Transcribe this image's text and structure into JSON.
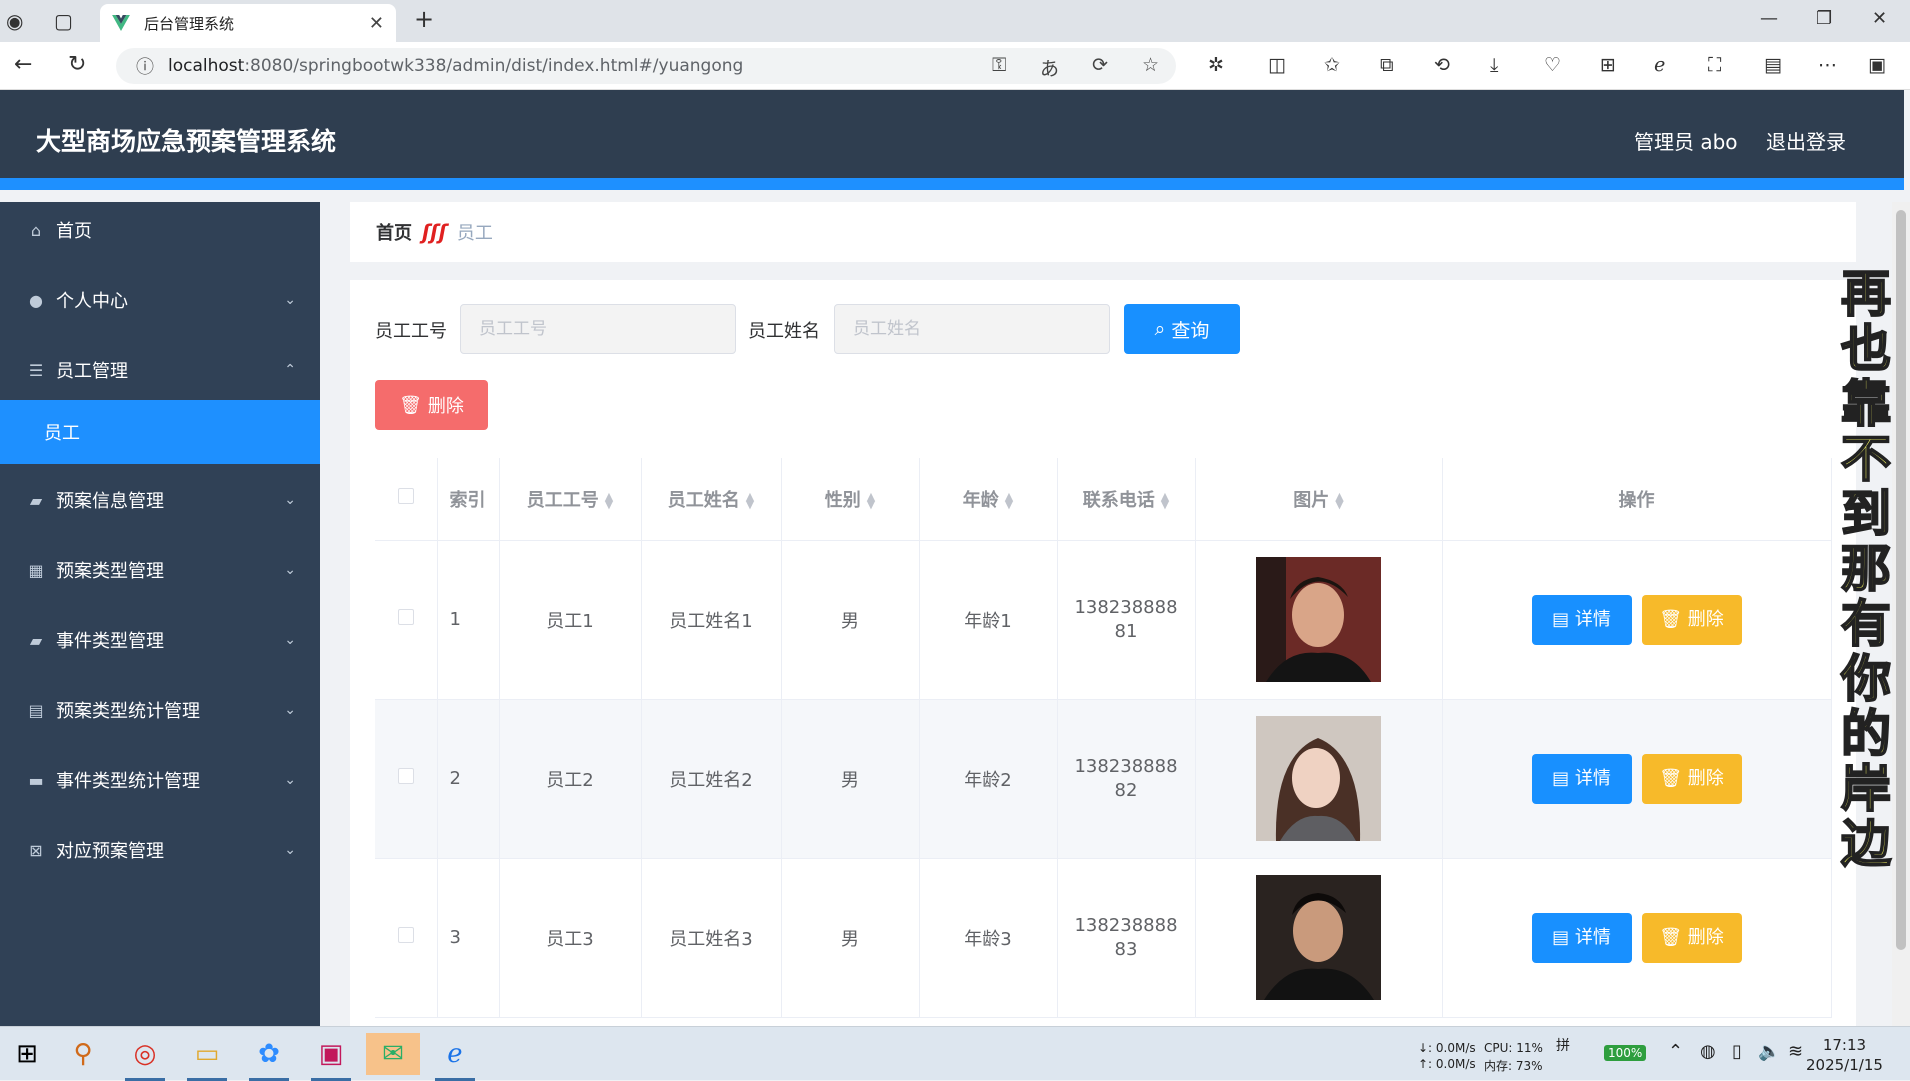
{
  "browser": {
    "tab_title": "后台管理系统",
    "url_host": "localhost",
    "url_path": ":8080/springbootwk338/admin/dist/index.html#/yuangong"
  },
  "header": {
    "title": "大型商场应急预案管理系统",
    "user_label": "管理员 abo",
    "logout_label": "退出登录"
  },
  "sidebar": {
    "items": [
      {
        "label": "首页",
        "icon": "home-icon"
      },
      {
        "label": "个人中心",
        "icon": "user-icon"
      },
      {
        "label": "员工管理",
        "icon": "sliders-icon"
      },
      {
        "label": "预案信息管理",
        "icon": "briefcase-icon"
      },
      {
        "label": "预案类型管理",
        "icon": "grid-icon"
      },
      {
        "label": "事件类型管理",
        "icon": "briefcase-icon"
      },
      {
        "label": "预案类型统计管理",
        "icon": "clipboard-icon"
      },
      {
        "label": "事件类型统计管理",
        "icon": "printer-icon"
      },
      {
        "label": "对应预案管理",
        "icon": "clipboard-x-icon"
      }
    ],
    "sub_active": "员工"
  },
  "breadcrumb": {
    "home": "首页",
    "separator": "ʃʃʃ",
    "current": "员工"
  },
  "search": {
    "id_label": "员工工号",
    "id_placeholder": "员工工号",
    "name_label": "员工姓名",
    "name_placeholder": "员工姓名",
    "query_label": "查询"
  },
  "actions": {
    "batch_delete_label": "删除"
  },
  "table": {
    "headers": [
      "索引",
      "员工工号",
      "员工姓名",
      "性别",
      "年龄",
      "联系电话",
      "图片",
      "操作"
    ],
    "rows": [
      {
        "index": "1",
        "id": "员工1",
        "name": "员工姓名1",
        "gender": "男",
        "age": "年龄1",
        "phone": "13823888881"
      },
      {
        "index": "2",
        "id": "员工2",
        "name": "员工姓名2",
        "gender": "男",
        "age": "年龄2",
        "phone": "13823888882"
      },
      {
        "index": "3",
        "id": "员工3",
        "name": "员工姓名3",
        "gender": "男",
        "age": "年龄3",
        "phone": "13823888883"
      }
    ],
    "detail_label": "详情",
    "delete_label": "删除"
  },
  "overlay": {
    "lyric": "再也靠不到那有你的岸边"
  },
  "taskbar": {
    "net_down": "↓: 0.0M/s",
    "net_up": "↑: 0.0M/s",
    "cpu": "CPU: 11%",
    "mem": "内存: 73%",
    "ime": "拼",
    "battery": "100%",
    "time": "17:13",
    "date": "2025/1/15"
  },
  "colors": {
    "header_bg": "#2f3e50",
    "accent": "#1e90ff",
    "sidebar_bg": "#304156",
    "danger": "#f56c6c",
    "warning": "#f7ba2a"
  }
}
